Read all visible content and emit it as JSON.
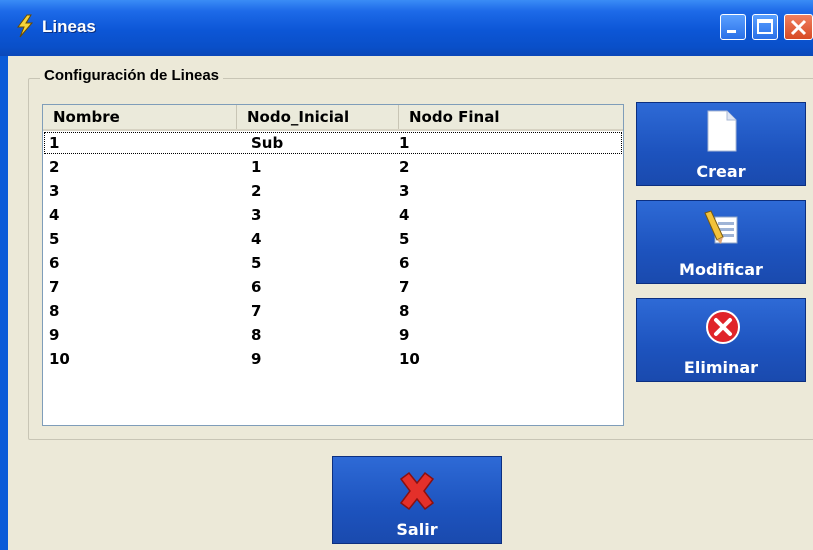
{
  "window": {
    "title": "Lineas"
  },
  "group": {
    "label": "Configuración de Lineas"
  },
  "table": {
    "columns": [
      "Nombre",
      "Nodo_Inicial",
      "Nodo Final"
    ],
    "rows": [
      [
        "1",
        "Sub",
        "1"
      ],
      [
        "2",
        "1",
        "2"
      ],
      [
        "3",
        "2",
        "3"
      ],
      [
        "4",
        "3",
        "4"
      ],
      [
        "5",
        "4",
        "5"
      ],
      [
        "6",
        "5",
        "6"
      ],
      [
        "7",
        "6",
        "7"
      ],
      [
        "8",
        "7",
        "8"
      ],
      [
        "9",
        "8",
        "9"
      ],
      [
        "10",
        "9",
        "10"
      ]
    ]
  },
  "buttons": {
    "crear": "Crear",
    "modificar": "Modificar",
    "eliminar": "Eliminar",
    "salir": "Salir"
  },
  "icons": {
    "title": "lightning-icon",
    "crear": "new-document-icon",
    "modificar": "edit-document-icon",
    "eliminar": "delete-circle-icon",
    "salir": "exit-x-icon"
  },
  "colors": {
    "titlebar": "#0a5bd8",
    "button": "#1d53be",
    "close": "#d84a24",
    "face": "#ece9d8"
  }
}
